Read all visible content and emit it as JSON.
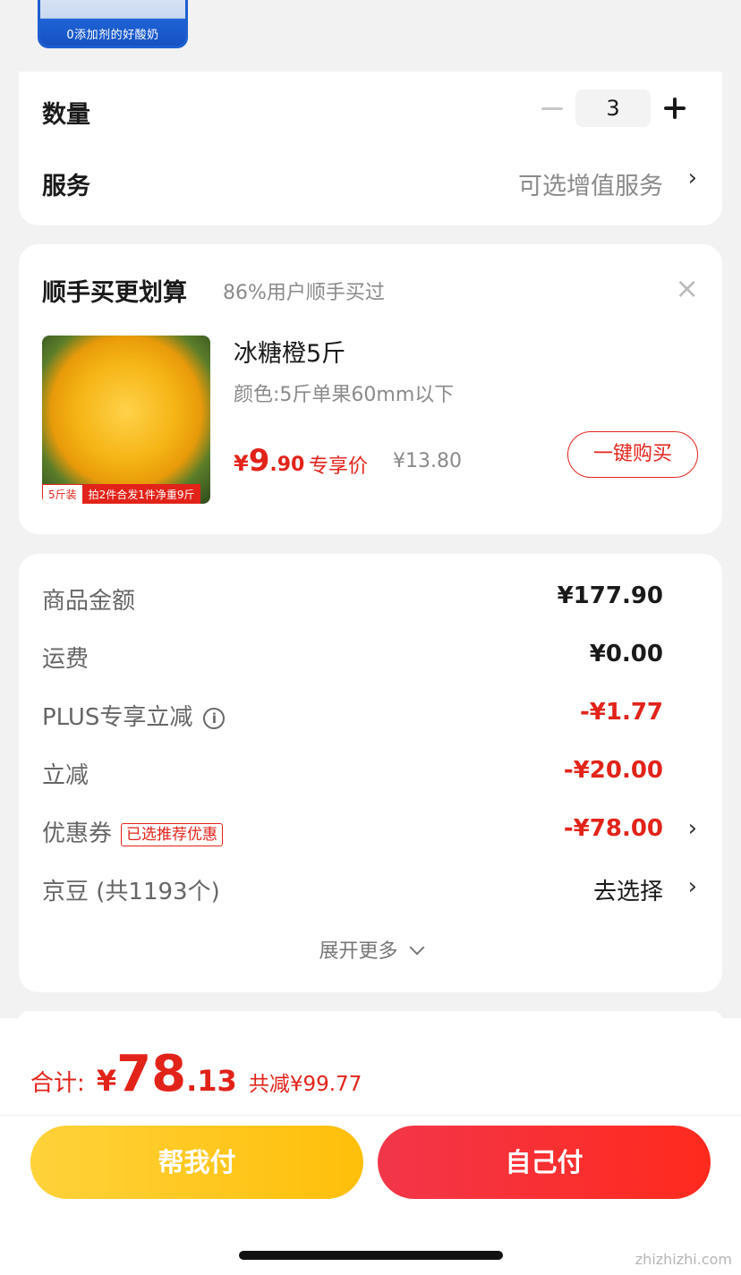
{
  "product_thumb": {
    "caption": "0添加剂的好酸奶"
  },
  "quantity": {
    "label": "数量",
    "value": "3",
    "minus": "−",
    "plus": "+"
  },
  "service": {
    "label": "服务",
    "value": "可选增值服务",
    "chevron": "›"
  },
  "addon": {
    "title": "顺手买更划算",
    "subtitle": "86%用户顺手买过",
    "close": "×",
    "item": {
      "name": "冰糖橙5斤",
      "spec": "颜色:5斤单果60mm以下",
      "price_symbol": "¥",
      "price_int": "9",
      "price_dec": ".90",
      "price_label": "专享价",
      "original_price": "¥13.80",
      "tag_pre": "5斤装",
      "tag_main": "拍2件合发1件净重9斤",
      "buy_button": "一键购买"
    }
  },
  "summary": {
    "rows": [
      {
        "label": "商品金额",
        "value": "¥177.90"
      },
      {
        "label": "运费",
        "value": "¥0.00"
      },
      {
        "label": "PLUS专享立减",
        "value": "-¥1.77"
      },
      {
        "label": "立减",
        "value": "-¥20.00"
      },
      {
        "label": "优惠券",
        "badge": "已选推荐优惠",
        "value": "-¥78.00"
      },
      {
        "label": "京豆 (共1193个)",
        "value": "去选择"
      }
    ],
    "expand": "展开更多",
    "info_icon": "i"
  },
  "footer": {
    "total_label": "合计:",
    "total_symbol": "¥",
    "total_int": "78",
    "total_dec": ".13",
    "saved": "共减¥99.77",
    "help_pay": "帮我付",
    "self_pay": "自己付"
  },
  "watermark": "zhizhizhi.com",
  "colors": {
    "accent_red": "#e2231a",
    "help_pay_start": "#ffd23a",
    "self_pay_start": "#f2364a"
  }
}
